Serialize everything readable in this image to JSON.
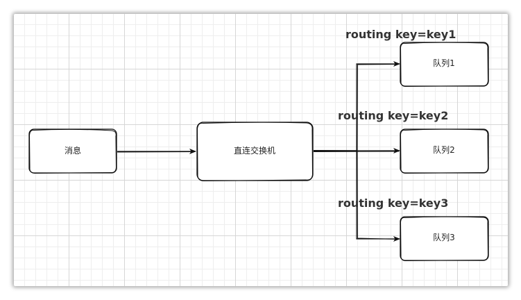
{
  "nodes": {
    "message": "消息",
    "exchange": "直连交换机",
    "queue1": "队列1",
    "queue2": "队列2",
    "queue3": "队列3"
  },
  "edges": {
    "key1_label": "routing key=key1",
    "key2_label": "routing key=key2",
    "key3_label": "routing key=key3"
  },
  "colors": {
    "stroke": "#111111",
    "grid": "#d6d6d6",
    "label": "#333333"
  }
}
